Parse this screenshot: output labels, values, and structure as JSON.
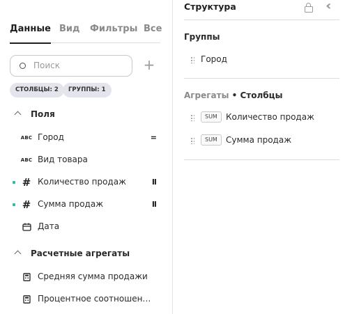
{
  "tabs": [
    "Данные",
    "Вид",
    "Фильтры",
    "Все"
  ],
  "search": {
    "placeholder": "Поиск",
    "add_icon": "plus-icon"
  },
  "chips": [
    "СТОЛБЦЫ: 2",
    "ГРУППЫ: 1"
  ],
  "fields_section": {
    "title": "Поля",
    "items": [
      {
        "icon": "ABC",
        "label": "Город",
        "marker": "="
      },
      {
        "icon": "ABC",
        "label": "Вид товара",
        "marker": ""
      },
      {
        "icon": "#",
        "label": "Количество продаж",
        "marker": "II"
      },
      {
        "icon": "#",
        "label": "Сумма продаж",
        "marker": "II"
      },
      {
        "icon": "calendar-icon",
        "label": "Дата",
        "marker": ""
      }
    ]
  },
  "calc_section": {
    "title": "Расчетные агрегаты",
    "items": [
      {
        "icon": "calculator-icon",
        "label": "Средняя сумма продажи"
      },
      {
        "icon": "calculator-icon",
        "label": "Процентное соотношен…"
      }
    ]
  },
  "structure": {
    "title": "Структура",
    "groups_title": "Группы",
    "groups": [
      "Город"
    ],
    "aggregates_title": "Агрегаты",
    "aggregates_sub": "• Столбцы",
    "aggregates": [
      {
        "fn": "SUM",
        "label": "Количество продаж"
      },
      {
        "fn": "SUM",
        "label": "Сумма продаж"
      }
    ]
  },
  "colors": {
    "accent_dot": "#35b7a8",
    "chip_bg": "#e4e4ec"
  }
}
